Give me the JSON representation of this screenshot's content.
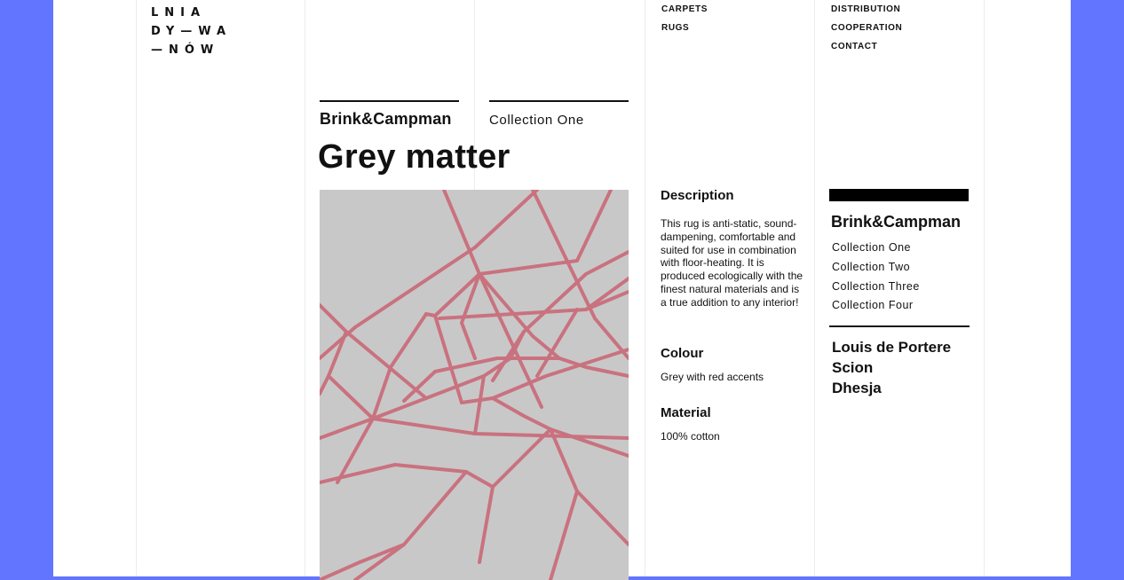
{
  "logo": {
    "line1": "LNIA",
    "line2": "DY—WA",
    "line3": "—NÓW"
  },
  "nav_left": [
    {
      "label": "CARPETS"
    },
    {
      "label": "RUGS"
    }
  ],
  "nav_right": [
    {
      "label": "DISTRIBUTION"
    },
    {
      "label": "COOPERATION"
    },
    {
      "label": "CONTACT"
    }
  ],
  "product": {
    "brand": "Brink&Campman",
    "collection": "Collection One",
    "title": "Grey matter"
  },
  "details": {
    "description_heading": "Description",
    "description_text": "This rug is anti-static, sound-dampening, comfortable and suited for use in combination with floor-heating. It is produced ecologically with the finest natural materials and is a true addition to any interior!",
    "colour_heading": "Colour",
    "colour_value": "Grey with red accents",
    "material_heading": "Material",
    "material_value": "100% cotton"
  },
  "sidebar": {
    "brand": "Brink&Campman",
    "collections": [
      {
        "label": "Collection One"
      },
      {
        "label": "Collection Two"
      },
      {
        "label": "Collection Three"
      },
      {
        "label": "Collection Four"
      }
    ],
    "other_brands": [
      {
        "label": "Louis de Portere"
      },
      {
        "label": "Scion"
      },
      {
        "label": "Dhesja"
      }
    ]
  },
  "colors": {
    "background": "#6275fe",
    "page": "#ffffff",
    "rug_base": "#c9c8c8",
    "rug_lines": "#c9727f",
    "text": "#111111"
  }
}
